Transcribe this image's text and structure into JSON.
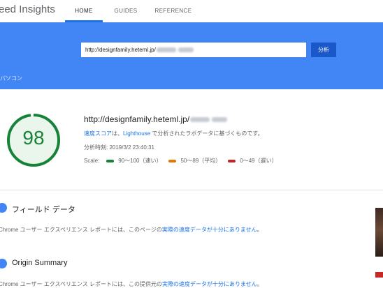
{
  "header": {
    "app_title": "eed Insights",
    "tabs": [
      {
        "label": "HOME",
        "active": true
      },
      {
        "label": "GUIDES",
        "active": false
      },
      {
        "label": "REFERENCE",
        "active": false
      }
    ]
  },
  "search": {
    "url_value": "http://designfamily.heteml.jp/",
    "analyze_label": "分析"
  },
  "device_tab": "パソコン",
  "summary": {
    "score": "98",
    "score_color": "#178239",
    "url": "http://designfamily.heteml.jp/",
    "desc_link1": "速度スコア",
    "desc_mid": "は、",
    "desc_link2": "Lighthouse",
    "desc_rest": " で分析されたラボデータに基づくものです。",
    "analyzed_time": "分析時刻: 2019/3/2 23:40:31",
    "scale_label": "Scale:",
    "scale": [
      {
        "text": "90〜100（速い）",
        "color": "#178239"
      },
      {
        "text": "50〜89（平均）",
        "color": "#e67700"
      },
      {
        "text": "0〜49（遅い）",
        "color": "#c7221f"
      }
    ]
  },
  "field_data": {
    "title": "フィールド データ",
    "text_prefix": "Chrome ユーザー エクスペリエンス レポートには、このページの",
    "text_link": "実際の速度データが十分にありません",
    "text_suffix": "。"
  },
  "origin_summary": {
    "title": "Origin Summary",
    "text_prefix": "Chrome ユーザー エクスペリエンス レポートには、この提供元の",
    "text_link": "実際の速度データが十分にありません",
    "text_suffix": "。"
  }
}
